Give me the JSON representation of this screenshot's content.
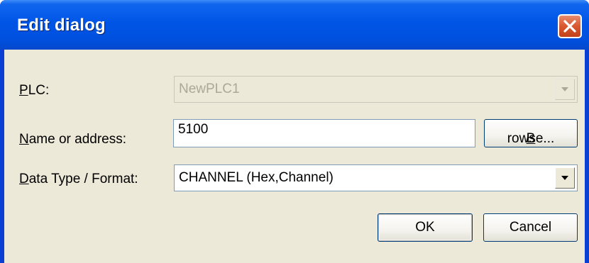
{
  "dialog": {
    "title": "Edit dialog"
  },
  "plc": {
    "label_key": "P",
    "label_rest": "LC:",
    "value": "NewPLC1"
  },
  "name": {
    "label_key": "N",
    "label_rest": "ame or address:",
    "value": "5100",
    "browse_key": "B",
    "browse_rest": "rowse..."
  },
  "datatype": {
    "label_key": "D",
    "label_rest": "ata Type / Format:",
    "value": "CHANNEL (Hex,Channel)"
  },
  "buttons": {
    "ok": "OK",
    "cancel": "Cancel"
  },
  "icons": {
    "close": "close-icon",
    "dropdown": "chevron-down-icon"
  },
  "colors": {
    "titlebar": "#0055e6",
    "close": "#d8582f",
    "client": "#ece9d8"
  }
}
